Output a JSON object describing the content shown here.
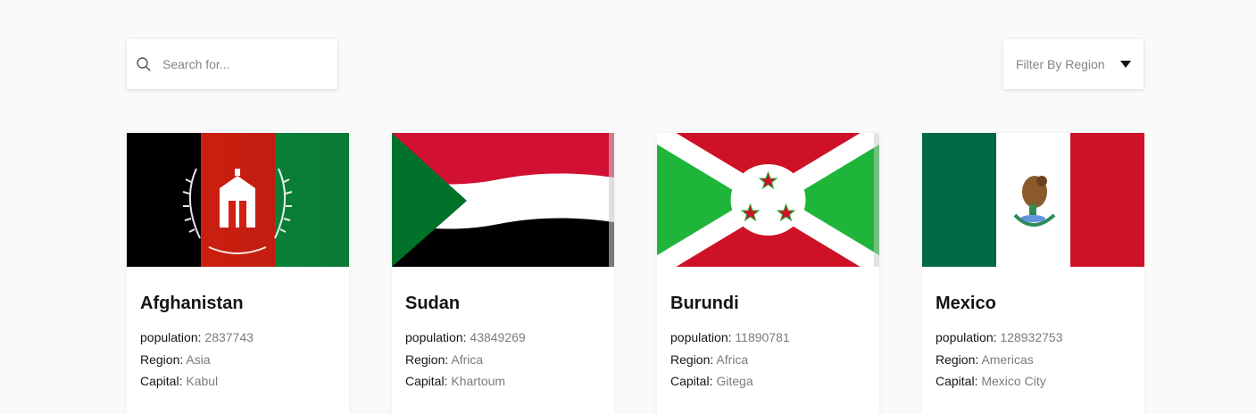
{
  "search": {
    "placeholder": "Search for...",
    "icon": "search-icon"
  },
  "filter": {
    "label": "Filter By Region",
    "icon": "caret-down-icon"
  },
  "labels": {
    "population": "population:",
    "region": "Region:",
    "capital": "Capital:"
  },
  "countries": [
    {
      "name": "Afghanistan",
      "population": "2837743",
      "region": "Asia",
      "capital": "Kabul"
    },
    {
      "name": "Sudan",
      "population": "43849269",
      "region": "Africa",
      "capital": "Khartoum"
    },
    {
      "name": "Burundi",
      "population": "11890781",
      "region": "Africa",
      "capital": "Gitega"
    },
    {
      "name": "Mexico",
      "population": "128932753",
      "region": "Americas",
      "capital": "Mexico City"
    }
  ],
  "colors": {
    "background": "#fafafa",
    "card": "#ffffff",
    "text": "#111517",
    "muted": "#7b7b7b"
  }
}
